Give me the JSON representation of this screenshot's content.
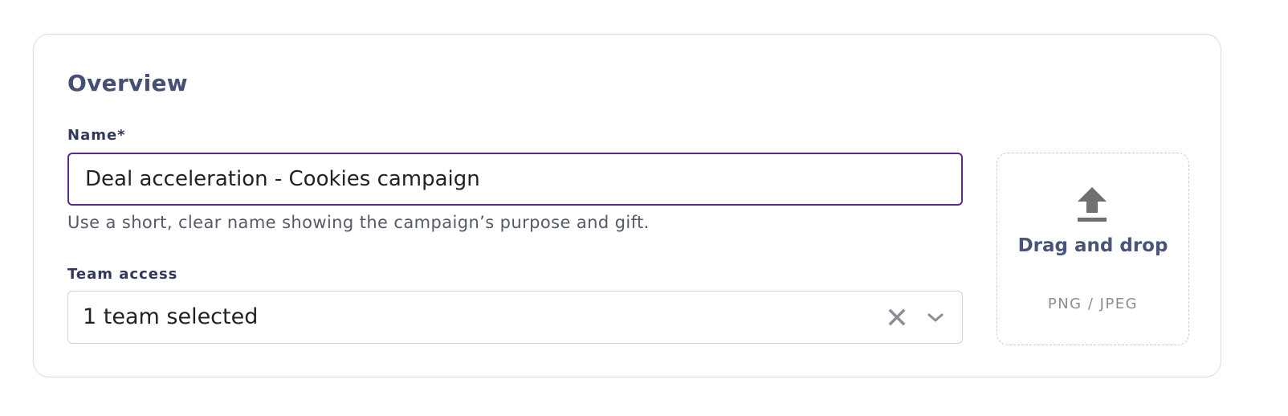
{
  "overview": {
    "title": "Overview",
    "name_label": "Name*",
    "name_value": "Deal acceleration - Cookies campaign",
    "name_helper": "Use a short, clear name showing the campaign’s purpose and gift.",
    "team_label": "Team access",
    "team_value": "1 team selected"
  },
  "upload": {
    "title": "Drag and drop",
    "formats": "PNG / JPEG",
    "icon": "upload-icon"
  },
  "icons": {
    "clear": "close-icon",
    "dropdown": "chevron-down-icon"
  },
  "colors": {
    "title": "#454f73",
    "label": "#30385c",
    "input_focus_border": "#5a2a91",
    "border": "#cfd2da",
    "icon_gray": "#8a8d96"
  }
}
